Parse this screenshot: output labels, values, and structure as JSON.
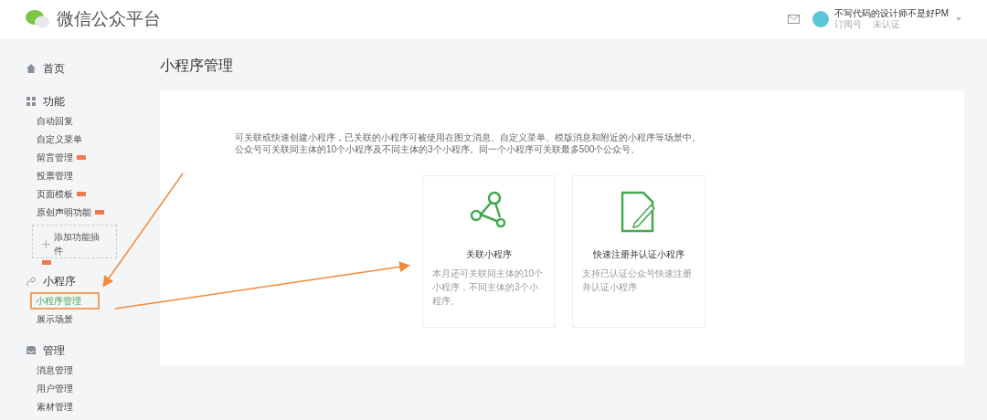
{
  "header": {
    "logo_text": "微信公众平台",
    "account_name": "不写代码的设计师不是好PM",
    "account_type": "订阅号",
    "verify_status": "未认证"
  },
  "sidebar": {
    "sections": [
      {
        "kind": "home",
        "title": "首页"
      },
      {
        "kind": "grid",
        "title": "功能",
        "items": [
          {
            "label": "自动回复",
            "badge": false,
            "selected": false
          },
          {
            "label": "自定义菜单",
            "badge": false,
            "selected": false
          },
          {
            "label": "留言管理",
            "badge": true,
            "selected": false
          },
          {
            "label": "投票管理",
            "badge": false,
            "selected": false
          },
          {
            "label": "页面模板",
            "badge": true,
            "selected": false
          },
          {
            "label": "原创声明功能",
            "badge": true,
            "selected": false
          }
        ],
        "add_plugin": {
          "label": "添加功能插件",
          "badge": true
        }
      },
      {
        "kind": "link",
        "title": "小程序",
        "items": [
          {
            "label": "小程序管理",
            "badge": false,
            "selected": true
          },
          {
            "label": "展示场景",
            "badge": false,
            "selected": false
          }
        ]
      },
      {
        "kind": "tray",
        "title": "管理",
        "items": [
          {
            "label": "消息管理",
            "badge": false,
            "selected": false
          },
          {
            "label": "用户管理",
            "badge": false,
            "selected": false
          },
          {
            "label": "素材管理",
            "badge": false,
            "selected": false
          }
        ]
      }
    ]
  },
  "page_title": "小程序管理",
  "intro": [
    "可关联或快速创建小程序，已关联的小程序可被使用在图文消息、自定义菜单、模版消息和附近的小程序等场景中。",
    "公众号可关联同主体的10个小程序及不同主体的3个小程序。同一个小程序可关联最多500个公众号。"
  ],
  "cards": [
    {
      "kind": "link",
      "title": "关联小程序",
      "description": "本月还可关联同主体的10个小程序，不同主体的3个小程序。"
    },
    {
      "kind": "register",
      "title": "快速注册并认证小程序",
      "description": "支持已认证公众号快速注册并认证小程序"
    }
  ]
}
